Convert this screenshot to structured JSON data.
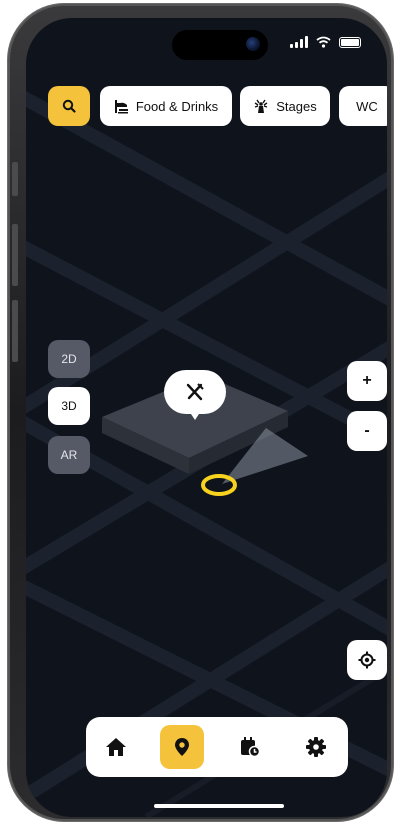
{
  "status_bar": {
    "signal_icon": "signal-bars-icon",
    "wifi_icon": "wifi-icon",
    "battery_icon": "battery-icon"
  },
  "search": {
    "icon": "search-icon"
  },
  "filters": [
    {
      "label": "Food & Drinks",
      "icon": "food-drinks-icon"
    },
    {
      "label": "Stages",
      "icon": "stages-icon"
    },
    {
      "label": "WC"
    }
  ],
  "view_modes": [
    {
      "label": "2D",
      "active": false
    },
    {
      "label": "3D",
      "active": true
    },
    {
      "label": "AR",
      "active": false
    }
  ],
  "zoom": {
    "in_label": "+",
    "out_label": "-"
  },
  "map": {
    "poi_icon": "utensils-icon",
    "user_marker": "user-location-ring"
  },
  "nav": [
    {
      "icon": "home-icon",
      "active": false
    },
    {
      "icon": "map-pin-icon",
      "active": true
    },
    {
      "icon": "calendar-clock-icon",
      "active": false
    },
    {
      "icon": "settings-icon",
      "active": false
    }
  ],
  "colors": {
    "accent": "#f5c33b",
    "map_bg": "#0f131b",
    "road": "#1c2230",
    "marker": "#f7d21e"
  }
}
